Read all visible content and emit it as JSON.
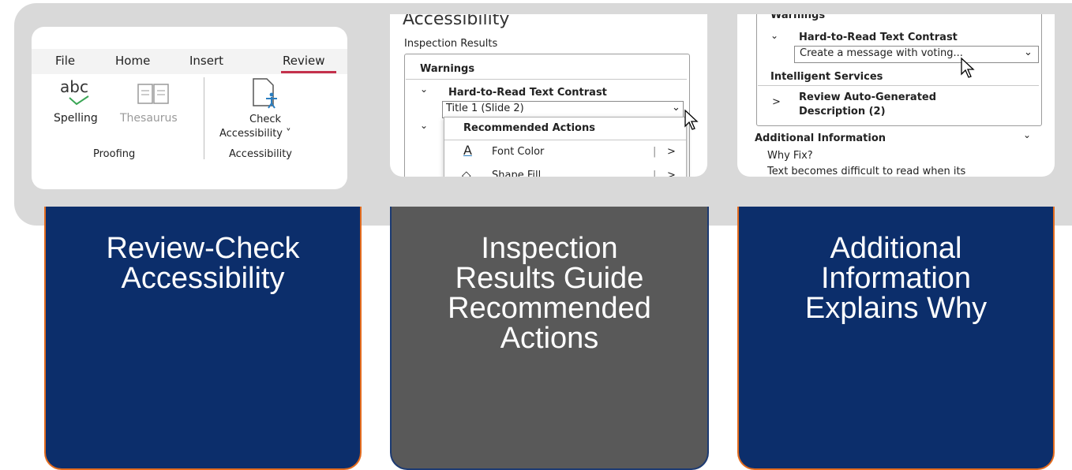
{
  "panel1": {
    "tabs": [
      "File",
      "Home",
      "Insert",
      "Review"
    ],
    "spelling_glyph": "abc",
    "spelling_label": "Spelling",
    "thesaurus_label": "Thesaurus",
    "check_label_1": "Check",
    "check_label_2": "Accessibility ˅",
    "group_proofing": "Proofing",
    "group_accessibility": "Accessibility"
  },
  "panel2": {
    "pane_title": "Accessibility",
    "inspection_results": "Inspection Results",
    "warnings": "Warnings",
    "issue": "Hard-to-Read Text Contrast",
    "item": "Title 1  (Slide 2)",
    "menu_title": "Recommended Actions",
    "actions": [
      "Font Color",
      "Shape Fill"
    ]
  },
  "panel3": {
    "warnings": "Warnings",
    "issue": "Hard-to-Read Text Contrast",
    "item": "Create a message with voting...",
    "intelligent_services": "Intelligent Services",
    "review_auto_1": "Review Auto-Generated",
    "review_auto_2": "Description (2)",
    "additional_info": "Additional Information",
    "why_fix": "Why Fix?",
    "explanation": "Text becomes difficult to read when its"
  },
  "cards": [
    {
      "lines": [
        "Review-Check",
        "Accessibility"
      ]
    },
    {
      "lines": [
        "Inspection",
        "Results Guide",
        "Recommended",
        "Actions"
      ]
    },
    {
      "lines": [
        "Additional",
        "Information",
        "Explains Why"
      ]
    }
  ],
  "colors": {
    "card_blue": "#0c2e6b",
    "card_gray": "#595959",
    "card_border": "#e36c1e",
    "band": "#d9d9d9",
    "review_underline": "#c4314b"
  }
}
